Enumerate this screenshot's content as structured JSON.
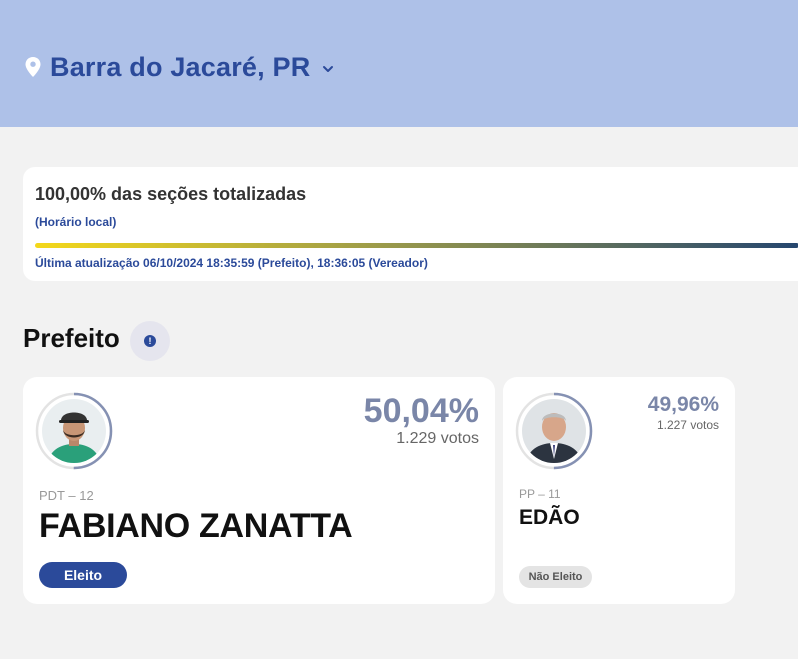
{
  "header": {
    "location": "Barra do Jacaré, PR",
    "background": "#aec1e8",
    "accent": "#2b4a9a",
    "icons": {
      "location": "map-pin-icon",
      "dropdown": "chevron-down-icon"
    }
  },
  "status": {
    "title": "100,00% das seções totalizadas",
    "subtitle": "(Horário local)",
    "progress_percent": 100,
    "last_update": "Última atualização 06/10/2024 18:35:59 (Prefeito), 18:36:05 (Vereador)"
  },
  "section": {
    "title": "Prefeito",
    "info_icon": "info-icon"
  },
  "candidates": [
    {
      "party": "PDT – 12",
      "name": "FABIANO ZANATTA",
      "percent": "50,04%",
      "votes": "1.229 votos",
      "status": "Eleito",
      "vote_share": 0.5004
    },
    {
      "party": "PP – 11",
      "name": "EDÃO",
      "percent": "49,96%",
      "votes": "1.227 votos",
      "status": "Não Eleito",
      "vote_share": 0.4996
    }
  ]
}
